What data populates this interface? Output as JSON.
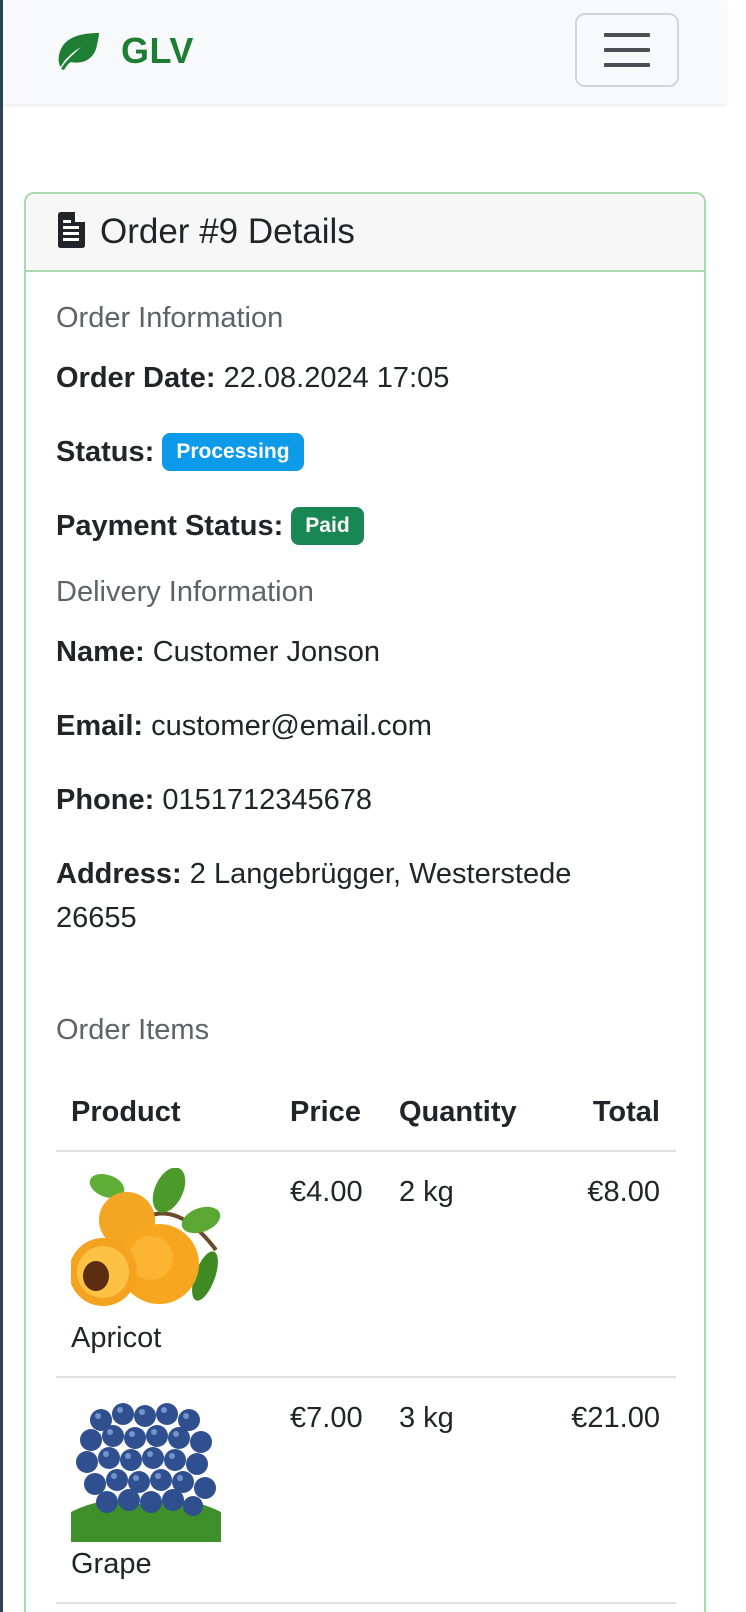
{
  "navbar": {
    "brand": "GLV",
    "brand_icon": "leaf-icon",
    "menu_icon": "hamburger-menu-icon",
    "brand_color": "#1e7e34"
  },
  "order": {
    "title": "Order #9 Details",
    "title_icon": "file-text-icon",
    "info_heading": "Order Information",
    "date_label": "Order Date:",
    "date_value": "22.08.2024 17:05",
    "status_label": "Status:",
    "status_value": "Processing",
    "status_color": "#0d9ae8",
    "payment_label": "Payment Status:",
    "payment_value": "Paid",
    "payment_color": "#198754"
  },
  "delivery": {
    "heading": "Delivery Information",
    "name_label": "Name:",
    "name_value": "Customer Jonson",
    "email_label": "Email:",
    "email_value": "customer@email.com",
    "phone_label": "Phone:",
    "phone_value": "0151712345678",
    "address_label": "Address:",
    "address_line1": "2 Langebrügger, Westerstede",
    "address_line2": "26655"
  },
  "items": {
    "heading": "Order Items",
    "columns": [
      "Product",
      "Price",
      "Quantity",
      "Total"
    ],
    "rows": [
      {
        "product": "Apricot",
        "image": "apricot-image",
        "price": "€4.00",
        "quantity": "2 kg",
        "total": "€8.00"
      },
      {
        "product": "Grape",
        "image": "grape-image",
        "price": "€7.00",
        "quantity": "3 kg",
        "total": "€21.00"
      }
    ]
  }
}
